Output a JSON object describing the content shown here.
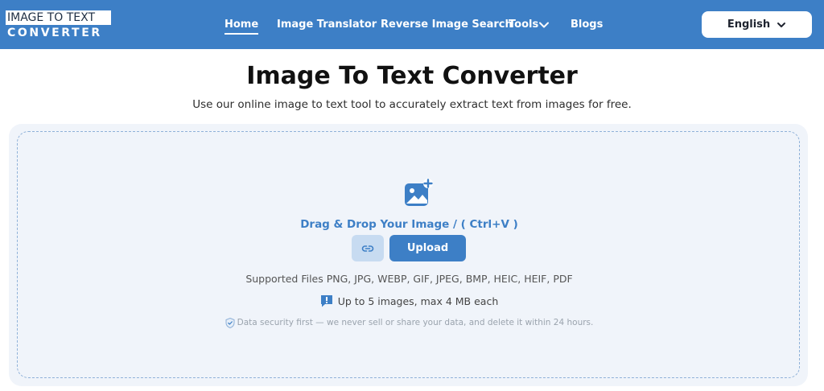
{
  "header": {
    "logo": {
      "line1": "IMAGE TO TEXT",
      "line2": "CONVERTER"
    },
    "nav": [
      {
        "label": "Home",
        "active": true
      },
      {
        "label": "Image Translator"
      },
      {
        "label": "Reverse Image Search"
      },
      {
        "label": "Tools",
        "has_dropdown": true
      },
      {
        "label": "Blogs"
      }
    ],
    "language": {
      "selected": "English"
    },
    "colors": {
      "bar": "#3d7fc6",
      "text": "#ffffff"
    }
  },
  "main": {
    "title": "Image To Text Converter",
    "subtitle": "Use our online image to text tool to accurately extract text from images for free."
  },
  "upload": {
    "icon": "add-image-icon",
    "drag_text": "Drag & Drop Your Image / ( Ctrl+V )",
    "link_icon": "link-icon",
    "upload_label": "Upload",
    "supported": "Supported Files PNG, JPG, WEBP, GIF, JPEG, BMP, HEIC, HEIF, PDF",
    "limit_icon": "info-chat-icon",
    "limit_text": "Up to 5 images, max 4 MB each",
    "security_icon": "shield-icon",
    "security_text": "Data security first — we never sell or share your data, and delete it within 24 hours.",
    "colors": {
      "accent": "#3d7fc6",
      "card_bg": "#f0f4fa",
      "link_btn": "#c7dbf1"
    }
  }
}
